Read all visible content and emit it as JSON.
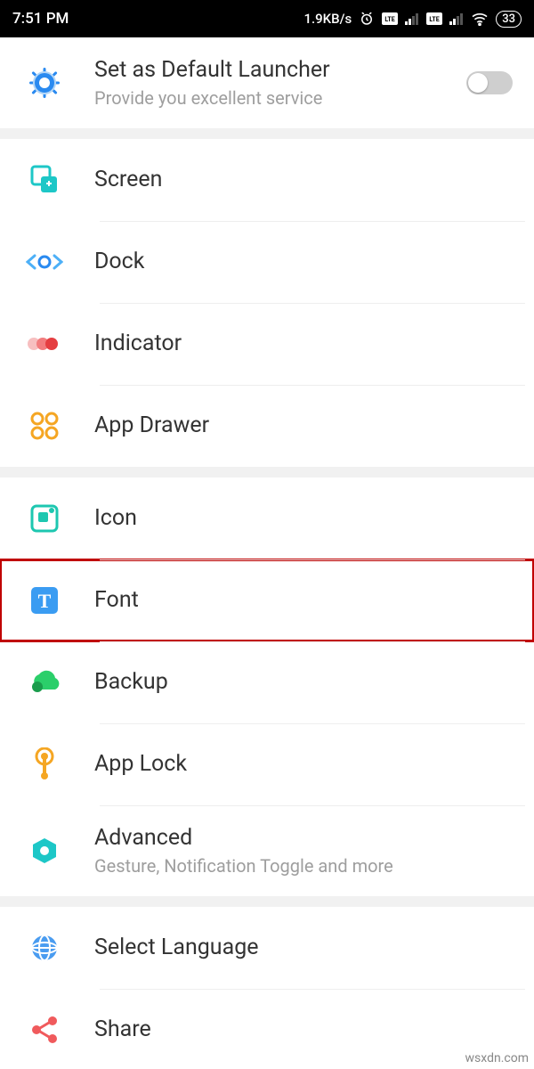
{
  "status": {
    "time": "7:51 PM",
    "speed": "1.9KB/s",
    "battery": "33"
  },
  "header": {
    "title": "Set as Default Launcher",
    "subtitle": "Provide you excellent service"
  },
  "group1": {
    "screen": "Screen",
    "dock": "Dock",
    "indicator": "Indicator",
    "appDrawer": "App Drawer"
  },
  "group2": {
    "icon": "Icon",
    "font": "Font",
    "backup": "Backup",
    "appLock": "App Lock",
    "advancedTitle": "Advanced",
    "advancedSub": "Gesture, Notification Toggle and more"
  },
  "group3": {
    "language": "Select Language",
    "share": "Share"
  },
  "watermark": "wsxdn.com"
}
